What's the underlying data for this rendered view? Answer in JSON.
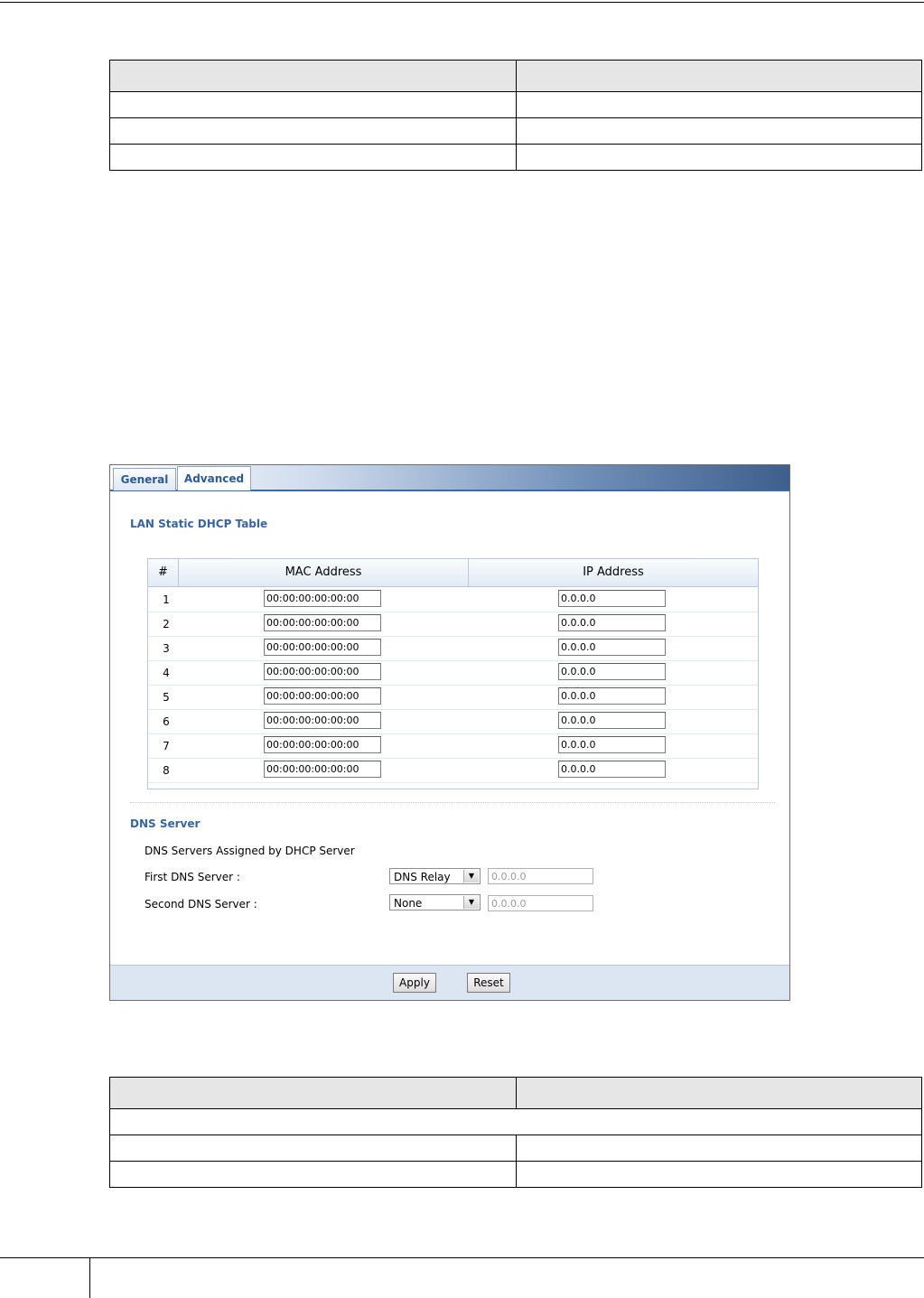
{
  "screenshot": {
    "tabs": [
      "General",
      "Advanced"
    ],
    "active_tab": "Advanced",
    "lan_section_title": "LAN Static DHCP Table",
    "dhcp_table": {
      "headers": [
        "#",
        "MAC Address",
        "IP Address"
      ],
      "rows": [
        {
          "num": "1",
          "mac": "00:00:00:00:00:00",
          "ip": "0.0.0.0"
        },
        {
          "num": "2",
          "mac": "00:00:00:00:00:00",
          "ip": "0.0.0.0"
        },
        {
          "num": "3",
          "mac": "00:00:00:00:00:00",
          "ip": "0.0.0.0"
        },
        {
          "num": "4",
          "mac": "00:00:00:00:00:00",
          "ip": "0.0.0.0"
        },
        {
          "num": "5",
          "mac": "00:00:00:00:00:00",
          "ip": "0.0.0.0"
        },
        {
          "num": "6",
          "mac": "00:00:00:00:00:00",
          "ip": "0.0.0.0"
        },
        {
          "num": "7",
          "mac": "00:00:00:00:00:00",
          "ip": "0.0.0.0"
        },
        {
          "num": "8",
          "mac": "00:00:00:00:00:00",
          "ip": "0.0.0.0"
        }
      ]
    },
    "dns_section_title": "DNS Server",
    "dns_assigned_label": "DNS Servers Assigned by DHCP Server",
    "first_dns": {
      "label": "First DNS Server :",
      "selected": "DNS Relay",
      "value": "0.0.0.0"
    },
    "second_dns": {
      "label": "Second DNS Server :",
      "selected": "None",
      "value": "0.0.0.0"
    },
    "buttons": {
      "apply": "Apply",
      "reset": "Reset"
    }
  },
  "colors": {
    "tab_text": "#2b5a9b",
    "section_title": "#3765a4",
    "footer_bg": "#dce6f3"
  }
}
